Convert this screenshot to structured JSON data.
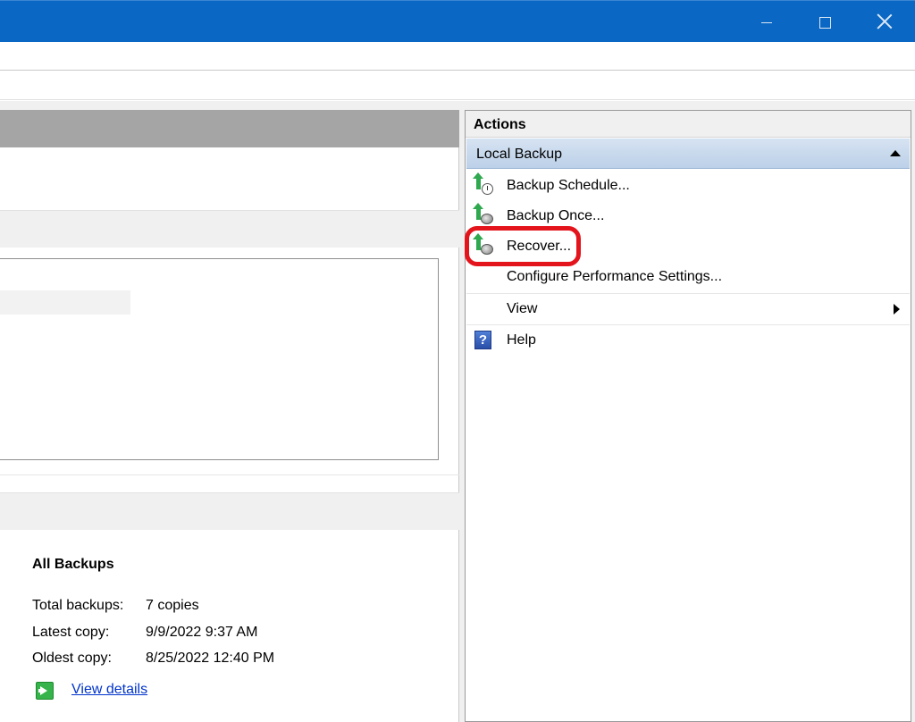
{
  "window": {
    "controls": {
      "minimize_icon": "minimize-icon",
      "maximize_icon": "maximize-icon",
      "close_icon": "close-icon"
    }
  },
  "summary": {
    "title": "All Backups",
    "rows": [
      {
        "label": "Total backups:",
        "value": "7 copies"
      },
      {
        "label": "Latest copy:",
        "value": "9/9/2022 9:37 AM"
      },
      {
        "label": "Oldest copy:",
        "value": "8/25/2022 12:40 PM"
      }
    ],
    "details_link": "View details"
  },
  "actions": {
    "header": "Actions",
    "group": "Local Backup",
    "items": [
      {
        "label": "Backup Schedule...",
        "icon": "backup-schedule-icon"
      },
      {
        "label": "Backup Once...",
        "icon": "backup-once-icon"
      },
      {
        "label": "Recover...",
        "icon": "recover-icon"
      },
      {
        "label": "Configure Performance Settings...",
        "icon": ""
      },
      {
        "label": "View",
        "icon": ""
      },
      {
        "label": "Help",
        "icon": "help-icon"
      }
    ]
  },
  "colors": {
    "titlebar": "#0a68c4",
    "highlight": "#e3141c",
    "link": "#0033cc"
  }
}
